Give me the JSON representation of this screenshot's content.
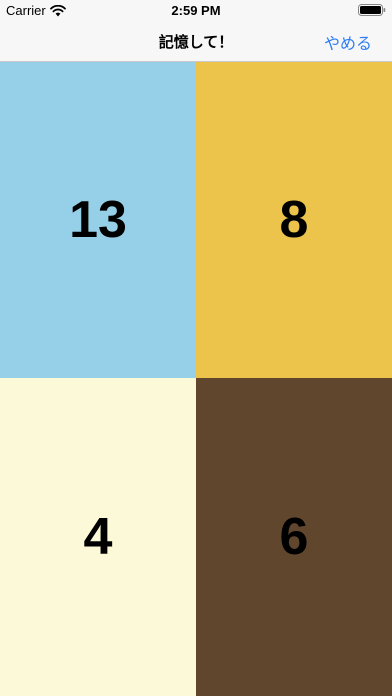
{
  "status_bar": {
    "carrier": "Carrier",
    "time": "2:59 PM"
  },
  "nav": {
    "title": "記憶して！",
    "quit_label": "やめる",
    "accent_color": "#2f7df6"
  },
  "tiles": [
    {
      "number": "13",
      "color": "#96d0e8"
    },
    {
      "number": "8",
      "color": "#ecc34b"
    },
    {
      "number": "4",
      "color": "#fbf9d7"
    },
    {
      "number": "6",
      "color": "#5f462d"
    }
  ],
  "icons": [
    "wifi-icon",
    "battery-icon"
  ]
}
